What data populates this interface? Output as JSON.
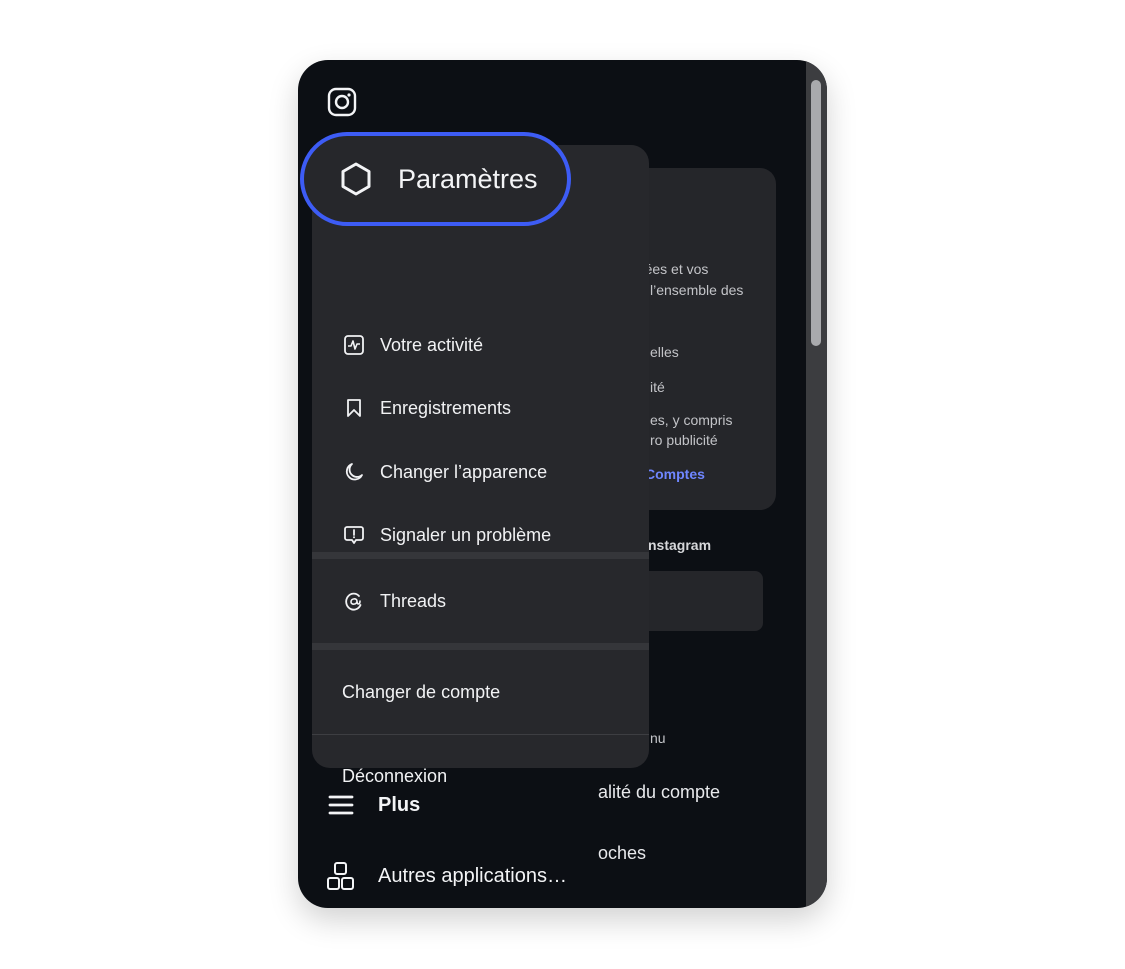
{
  "app": {
    "logo_icon": "instagram-logo-icon"
  },
  "highlight": {
    "label": "Paramètres",
    "icon": "gear-icon",
    "accent": "#3d5cf5"
  },
  "menu": {
    "items": [
      {
        "label": "Votre activité",
        "icon": "activity-icon"
      },
      {
        "label": "Enregistrements",
        "icon": "bookmark-icon"
      },
      {
        "label": "Changer l’apparence",
        "icon": "moon-icon"
      },
      {
        "label": "Signaler un problème",
        "icon": "report-icon"
      }
    ],
    "threads": {
      "label": "Threads",
      "icon": "threads-icon"
    },
    "switch_account": "Changer de compte",
    "logout": "Déconnexion"
  },
  "nav": {
    "more": {
      "label": "Plus",
      "icon": "menu-icon"
    },
    "other_apps": {
      "label": "Autres applications…",
      "icon": "apps-icon"
    }
  },
  "background": {
    "card_lines": [
      "ngées et vos",
      "l’ensemble des",
      "elles",
      "ité",
      "es, y compris",
      "ro publicité"
    ],
    "card_link": "Comptes",
    "section_label": "nstagram",
    "lines": [
      "nu",
      "alité du compte",
      "oches"
    ]
  }
}
